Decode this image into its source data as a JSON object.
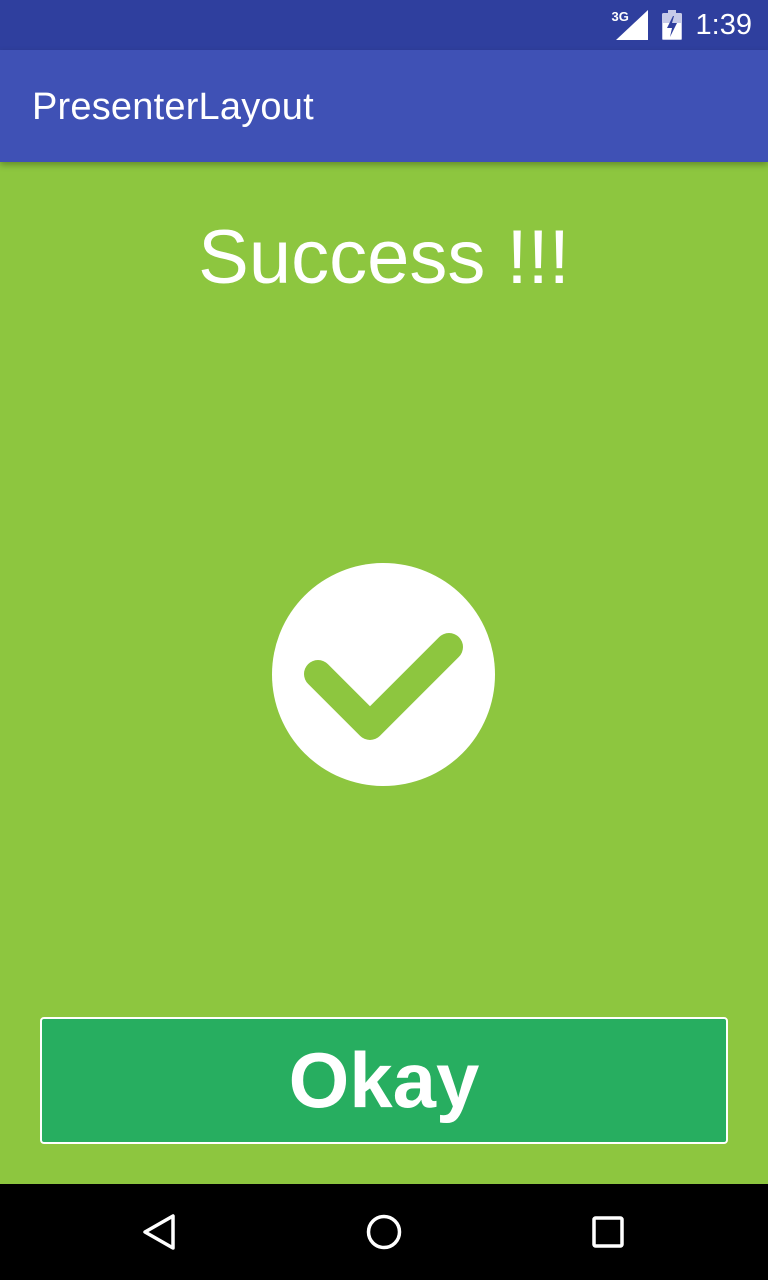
{
  "status_bar": {
    "network_type": "3G",
    "time": "1:39",
    "icons": [
      "signal-icon",
      "battery-charging-icon"
    ]
  },
  "app_bar": {
    "title": "PresenterLayout"
  },
  "content": {
    "heading": "Success !!!",
    "status_icon": "check-circle-icon",
    "ok_button_label": "Okay"
  },
  "navigation_bar": {
    "items": [
      "back-icon",
      "home-icon",
      "recents-icon"
    ]
  },
  "colors": {
    "status_bar": "#2f3f9e",
    "app_bar": "#3f51b5",
    "background": "#8dc63f",
    "button": "#27ae60",
    "text": "#ffffff",
    "nav_bar": "#000000"
  }
}
